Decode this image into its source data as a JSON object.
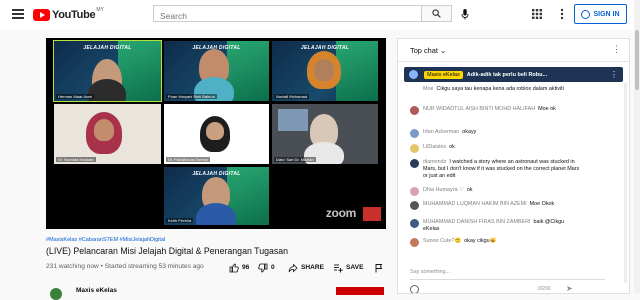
{
  "header": {
    "logo_text": "YouTube",
    "logo_country": "MY",
    "search_placeholder": "Search",
    "signin_label": "SIGN IN"
  },
  "video": {
    "participants": [
      {
        "name": "Herman Maar Azmi"
      },
      {
        "name": "Puan Haryani Binti Bakrun"
      },
      {
        "name": "Norlaili Mohamad"
      },
      {
        "name": "Dr. Noraida Mustafa"
      },
      {
        "name": "Dr. Faizahzura Osman"
      },
      {
        "name": "Dato' Sari Dr. Mazlan"
      },
      {
        "name": "Keith Pereira"
      }
    ],
    "slide_title": "JELAJAH DIGITAL",
    "zoom_label": "zoom",
    "hashtags": "#MaxisKelas #CabaranSTEM #MisiJelajahDigital",
    "title": "(LIVE) Pelancaran Misi Jelajah Digital & Penerangan Tugasan",
    "meta": "231 watching now • Started streaming 53 minutes ago",
    "likes": "96",
    "dislikes": "0",
    "share_label": "SHARE",
    "save_label": "SAVE",
    "channel_name": "Maxis eKelas"
  },
  "chat": {
    "header": "Top chat",
    "pinned": {
      "author": "Maxis eKelas",
      "message": "Adik-adik tak perlu beli Robu..."
    },
    "messages": [
      {
        "author": "Moe",
        "text": "Cikgu saya tau kenapa kena ada roblox dalam aktiviti",
        "color": "#d8d8d8"
      },
      {
        "author": "NUR WIDADTUL AISH BINTI MOHD HALIFAH",
        "text": "Moe ok",
        "color": "#b05a5a"
      },
      {
        "author": "Irfan Ackerman",
        "text": "okayy",
        "color": "#7a9bc4"
      },
      {
        "author": "LilDaisies",
        "text": "ok",
        "color": "#e3c56a"
      },
      {
        "author": "diamondz",
        "text": "I watched a story where an astronaut was stucked in Mars, but I don't know if it was stucked on the correct planet Mars or just an edit",
        "color": "#2a3a5a"
      },
      {
        "author": "Dhia Humayra ♡",
        "text": "ok",
        "color": "#d9a0b8"
      },
      {
        "author": "MUHAMMAD LUQMAN HAKIM BIN AZEMI",
        "text": "Moe Okok",
        "color": "#555555"
      },
      {
        "author": "MUHAMMAD DANISH FIRAS BIN ZAMBERI",
        "text": "baik @Cikgu eKelas",
        "color": "#3f5a7a"
      },
      {
        "author": "Sunoo Cute?🙂",
        "text": "okay cikgu😺",
        "color": "#c47a5a"
      }
    ],
    "input_placeholder": "Say something...",
    "counter": "0/200"
  }
}
